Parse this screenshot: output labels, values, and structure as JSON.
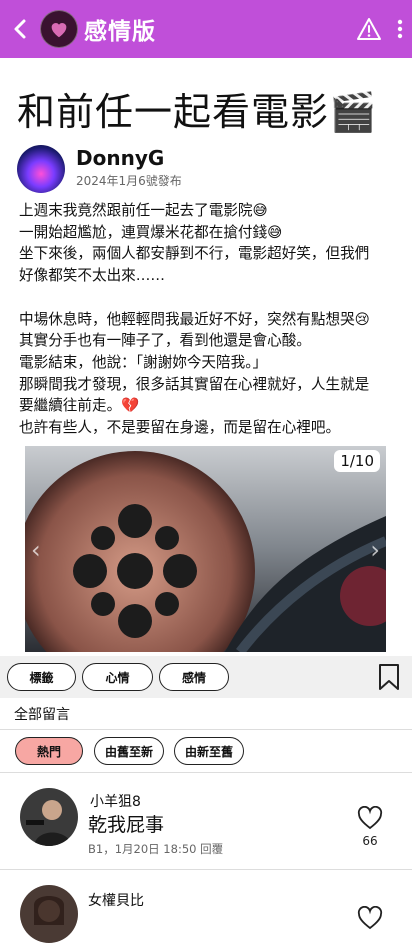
{
  "header": {
    "board_title": "感情版",
    "back_icon": "back-arrow-icon",
    "report_icon": "warning-triangle-icon",
    "menu_icon": "more-vertical-icon",
    "bg_color": "#c04fd9"
  },
  "post": {
    "title": "和前任一起看電影🎬",
    "author": "DonnyG",
    "date": "2024年1月6號發布",
    "body_lines": [
      "上週末我竟然跟前任一起去了電影院😅",
      "一開始超尷尬，連買爆米花都在搶付錢😅",
      "坐下來後，兩個人都安靜到不行，電影超好笑，但我們",
      "好像都笑不太出來……",
      "",
      "中場休息時，他輕輕問我最近好不好，突然有點想哭😢",
      "其實分手也有一陣子了，看到他還是會心酸。",
      "電影結束，他說：「謝謝妳今天陪我。」",
      "那瞬間我才發現，很多話其實留在心裡就好，人生就是",
      "要繼續往前走。💔",
      "也許有些人，不是要留在身邊，而是留在心裡吧。"
    ],
    "photo_counter": "1/10"
  },
  "tags": [
    "標籤",
    "心情",
    "感情"
  ],
  "comments_section": {
    "label": "全部留言",
    "sort_options": [
      "熱門",
      "由舊至新",
      "由新至舊"
    ],
    "active_sort": "熱門"
  },
  "comments": [
    {
      "user": "小羊狙8",
      "text": "乾我屁事",
      "meta": "B1，1月20日 18:50 回覆",
      "likes": "66"
    },
    {
      "user": "女權貝比",
      "text": "",
      "meta": "",
      "likes": ""
    }
  ],
  "colors": {
    "accent": "#c04fd9",
    "active_sort": "#f7a7a3",
    "tag_bar": "#f0f0f0"
  }
}
